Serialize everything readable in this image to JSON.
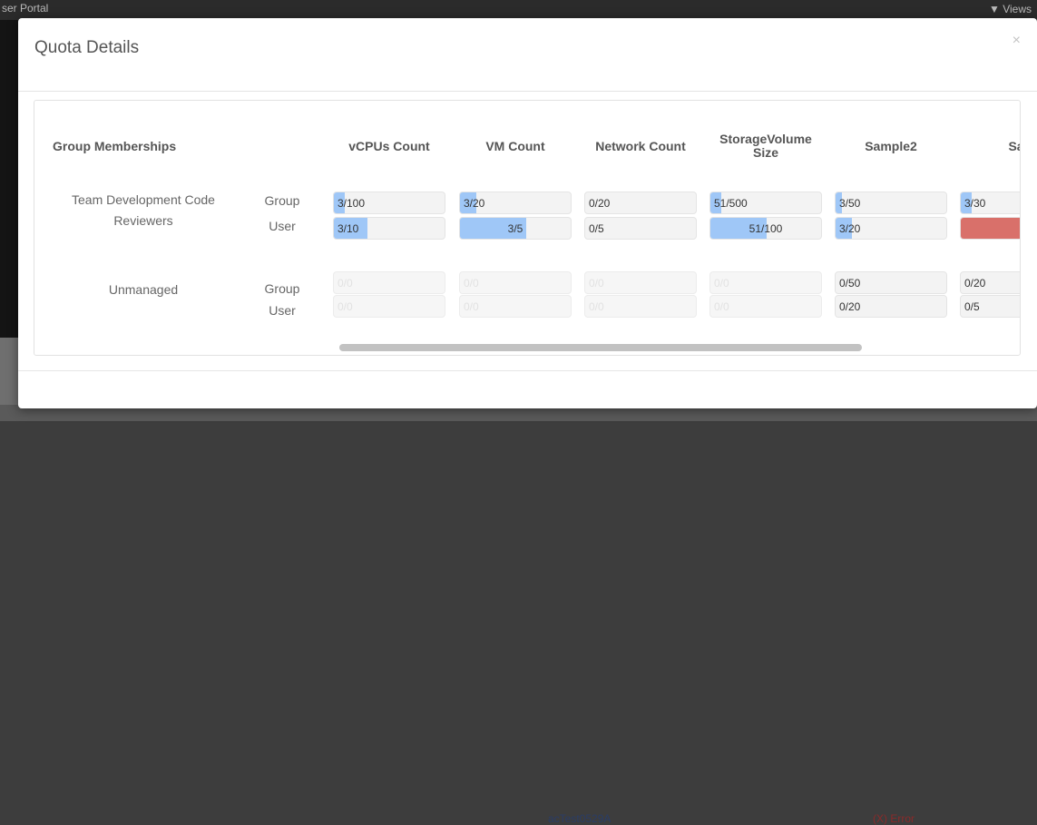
{
  "background": {
    "window_title": "ser Portal",
    "views_label": "Views",
    "row_name": "acTest0529A",
    "row_status": "(X) Error"
  },
  "modal": {
    "title": "Quota Details",
    "close_glyph": "×"
  },
  "table": {
    "group_header": "Group Memberships",
    "columns": [
      {
        "label": "vCPUs Count"
      },
      {
        "label": "VM Count"
      },
      {
        "label": "Network Count"
      },
      {
        "label": "StorageVolume Size"
      },
      {
        "label": "Sample2"
      },
      {
        "label": "Sa"
      }
    ],
    "groups": [
      {
        "name": "Team Development Code Reviewers",
        "rows": [
          {
            "type": "Group",
            "cells": [
              {
                "text": "3/100",
                "fraction": 0.1
              },
              {
                "text": "3/20",
                "fraction": 0.15
              },
              {
                "text": "0/20",
                "fraction": 0
              },
              {
                "text": "51/500",
                "fraction": 0.1
              },
              {
                "text": "3/50",
                "fraction": 0.06
              },
              {
                "text": "3/30",
                "fraction": 0.1
              }
            ]
          },
          {
            "type": "User",
            "cells": [
              {
                "text": "3/10",
                "fraction": 0.3
              },
              {
                "text": "3/5",
                "fraction": 0.6
              },
              {
                "text": "0/5",
                "fraction": 0
              },
              {
                "text": "51/100",
                "fraction": 0.51
              },
              {
                "text": "3/20",
                "fraction": 0.15
              },
              {
                "text": "",
                "fraction": 1.0,
                "status": "exceeded"
              }
            ]
          }
        ]
      },
      {
        "name": "Unmanaged",
        "rows": [
          {
            "type": "Group",
            "cells": [
              {
                "text": "0/0",
                "disabled": true
              },
              {
                "text": "0/0",
                "disabled": true
              },
              {
                "text": "0/0",
                "disabled": true
              },
              {
                "text": "0/0",
                "disabled": true
              },
              {
                "text": "0/50"
              },
              {
                "text": "0/20"
              }
            ]
          },
          {
            "type": "User",
            "cells": [
              {
                "text": "0/0",
                "disabled": true
              },
              {
                "text": "0/0",
                "disabled": true
              },
              {
                "text": "0/0",
                "disabled": true
              },
              {
                "text": "0/0",
                "disabled": true
              },
              {
                "text": "0/20"
              },
              {
                "text": "0/5"
              }
            ]
          }
        ]
      }
    ]
  },
  "colors": {
    "bar_fill": "#9fc7f7",
    "bar_exceeded": "#d9706a"
  }
}
